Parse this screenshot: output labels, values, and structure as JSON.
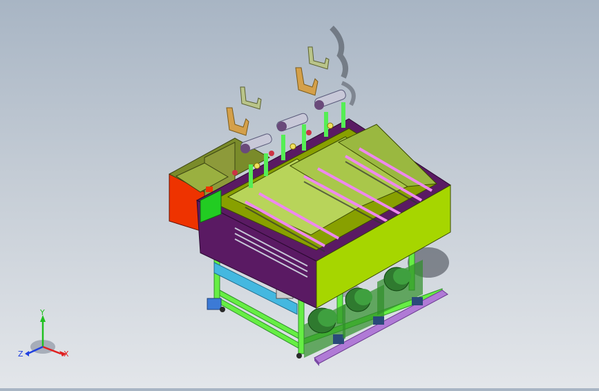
{
  "scene": {
    "type": "3d-cad-model-viewport",
    "colors": {
      "frame": "#66ee44",
      "frame_dark": "#2f8f2a",
      "purple_panel": "#5a1a63",
      "lime_panel": "#a6d600",
      "orange_panel": "#ee3300",
      "olive_box": "#7a8b2a",
      "pink_rods": "#ee88ee",
      "motor_green": "#2f7a2f",
      "base_rail": "#b07ad6",
      "pipe_grey": "#c8c8d8",
      "bracket_orange": "#d4a04a",
      "bracket_olive": "#b9c48a"
    }
  },
  "triad": {
    "x_label": "X",
    "y_label": "Y",
    "z_label": "Z",
    "colors": {
      "x": "#e02020",
      "y": "#20c020",
      "z": "#2040e0"
    }
  }
}
